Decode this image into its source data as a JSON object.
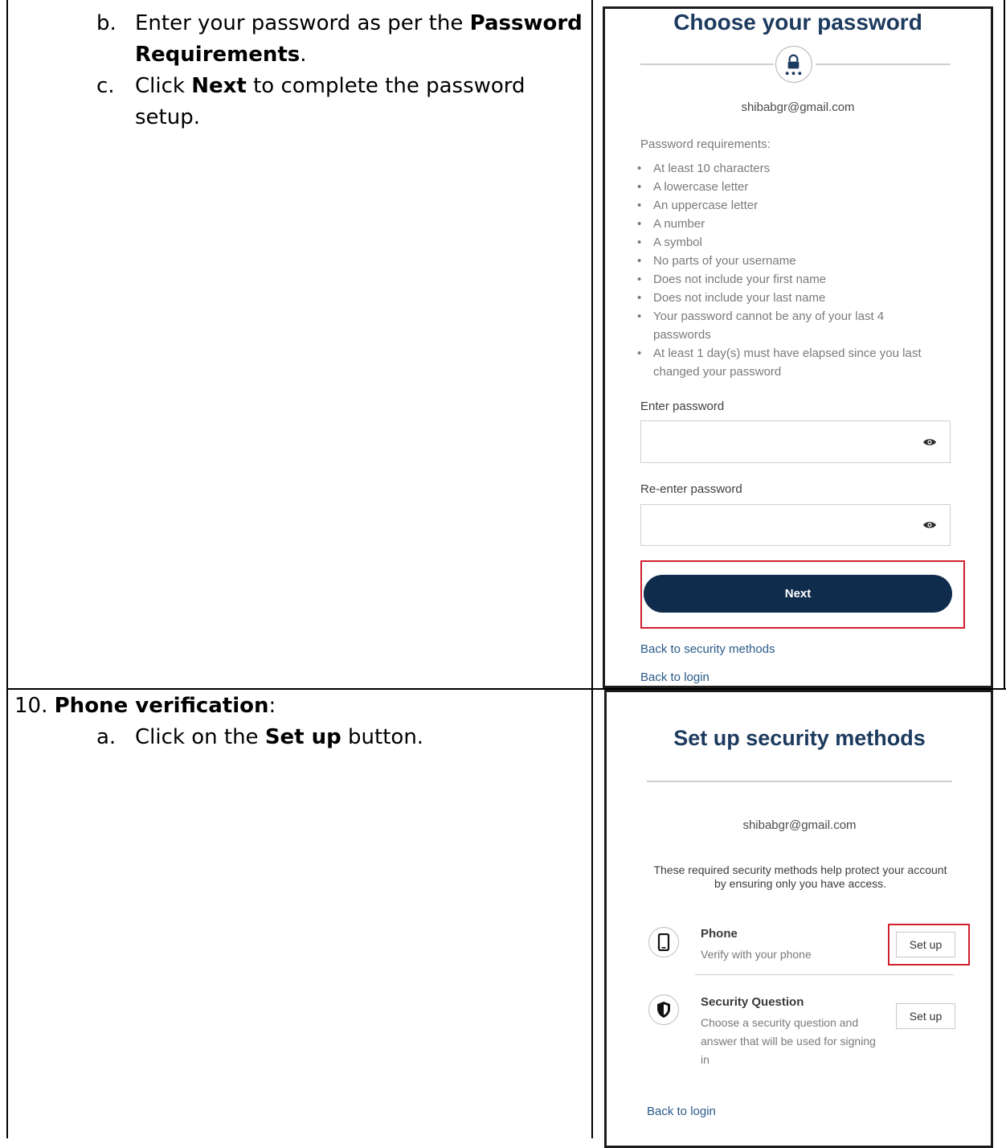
{
  "step_b": {
    "letter": "b.",
    "line1_pre": "Enter your password as per the ",
    "line1_bold": "Password",
    "line2_bold": "Requirements",
    "line2_post": "."
  },
  "step_c": {
    "letter": "c.",
    "line1_pre": "Click ",
    "line1_bold": "Next",
    "line1_post": " to complete the password",
    "line2": "setup."
  },
  "step10": {
    "number": "10. ",
    "bold": "Phone verification",
    "post": ":"
  },
  "step10_a": {
    "letter": "a.",
    "pre": "Click on the ",
    "bold": "Set up",
    "post": " button."
  },
  "password_screen": {
    "title": "Choose your password",
    "email": "shibabgr@gmail.com",
    "requirements_heading": "Password requirements:",
    "requirements": [
      "At least 10 characters",
      "A lowercase letter",
      "An uppercase letter",
      "A number",
      "A symbol",
      "No parts of your username",
      "Does not include your first name",
      "Does not include your last name",
      "Your password cannot be any of your last 4 passwords",
      "At least 1 day(s) must have elapsed since you last changed your password"
    ],
    "enter_label": "Enter password",
    "reenter_label": "Re-enter password",
    "next_label": "Next",
    "back_security": "Back to security methods",
    "back_login": "Back to login",
    "icon": "lock-icon"
  },
  "security_screen": {
    "title": "Set up security methods",
    "email": "shibabgr@gmail.com",
    "description": "These required security methods help protect your account by ensuring only you have access.",
    "methods": [
      {
        "name": "Phone",
        "desc": "Verify with your phone",
        "button": "Set up",
        "icon": "phone-icon"
      },
      {
        "name": "Security Question",
        "desc": "Choose a security question and answer that will be used for signing in",
        "button": "Set up",
        "icon": "shield-icon"
      }
    ],
    "back_login": "Back to login"
  },
  "colors": {
    "navy": "#1c3a5e",
    "button": "#0f2c4d",
    "highlight": "#d0202e",
    "link": "#2a5a8a"
  }
}
